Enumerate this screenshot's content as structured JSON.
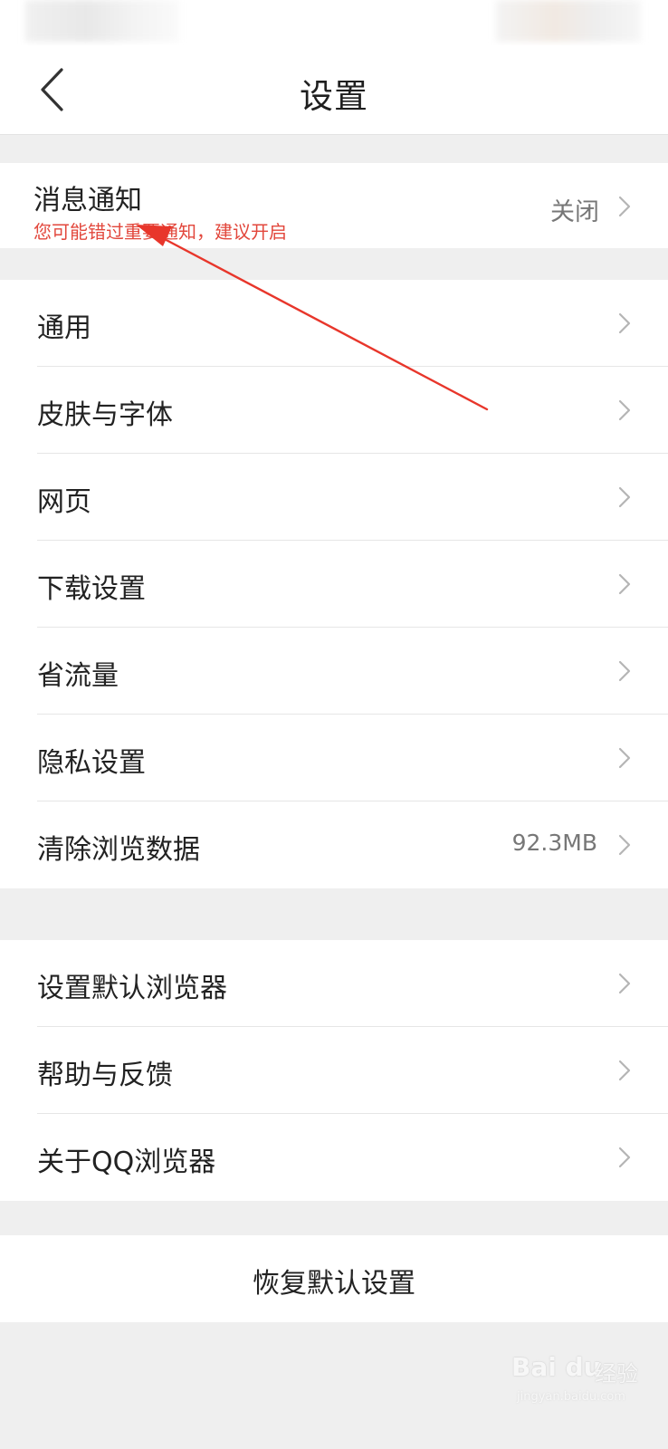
{
  "header": {
    "title": "设置"
  },
  "notification": {
    "label": "消息通知",
    "hint": "您可能错过重要通知，建议开启",
    "value": "关闭"
  },
  "group1": {
    "items": [
      {
        "label": "通用",
        "value": ""
      },
      {
        "label": "皮肤与字体",
        "value": ""
      },
      {
        "label": "网页",
        "value": ""
      },
      {
        "label": "下载设置",
        "value": ""
      },
      {
        "label": "省流量",
        "value": ""
      },
      {
        "label": "隐私设置",
        "value": ""
      },
      {
        "label": "清除浏览数据",
        "value": "92.3MB"
      }
    ]
  },
  "group2": {
    "items": [
      {
        "label": "设置默认浏览器"
      },
      {
        "label": "帮助与反馈"
      },
      {
        "label": "关于QQ浏览器"
      }
    ]
  },
  "reset": {
    "label": "恢复默认设置"
  },
  "annotation": {
    "arrow_color": "#e8362b"
  },
  "watermark": {
    "main": "Bai du",
    "cn": "经验",
    "url": "jingyan.baidu.com"
  },
  "colors": {
    "hint": "#e2473c",
    "background": "#efefef",
    "card": "#ffffff"
  }
}
